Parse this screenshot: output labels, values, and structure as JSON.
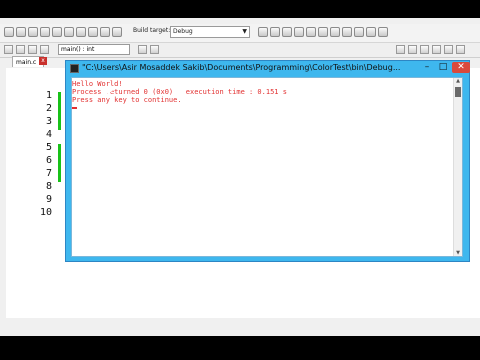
{
  "toolbar": {
    "build_target_label": "Build target:",
    "build_target_value": "Debug"
  },
  "scope": {
    "value": "main() : int"
  },
  "editor": {
    "tab_label": "main.c",
    "line_numbers": [
      "1",
      "2",
      "3",
      "4",
      "5",
      "6",
      "7",
      "8",
      "9",
      "10"
    ]
  },
  "console": {
    "title": "\"C:\\Users\\Asir Mosaddek Sakib\\Documents\\Programming\\ColorTest\\bin\\Debug...",
    "lines": [
      "Hello World!",
      "Process returned 0 (0x0)   execution time : 0.151 s",
      "Press any key to continue."
    ]
  },
  "colors": {
    "console_text": "#e23131",
    "console_frame": "#3eb7ee",
    "change_marker": "#19c219"
  }
}
